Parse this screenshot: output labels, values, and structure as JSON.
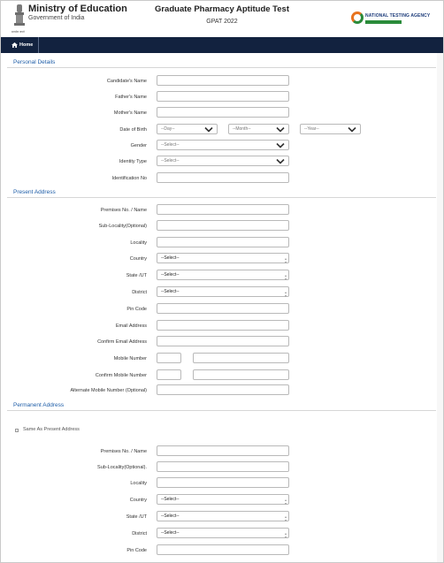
{
  "header": {
    "ministry": "Ministry of Education",
    "government": "Government of India",
    "emblem_caption": "सत्यमेव जयते",
    "title": "Graduate Pharmacy Aptitude Test",
    "subtitle": "GPAT 2022",
    "agency": "NATIONAL TESTING AGENCY"
  },
  "nav": {
    "home": "Home"
  },
  "personal": {
    "heading": "Personal Details",
    "candidate_name": "Candidate's Name",
    "father_name": "Father's Name",
    "mother_name": "Mother's Name",
    "dob": "Date of Birth",
    "dob_day": "--Day--",
    "dob_month": "--Month--",
    "dob_year": "--Year--",
    "gender": "Gender",
    "gender_select": "--Select--",
    "identity_type": "Identity Type",
    "identity_select": "--Select--",
    "identification_no": "Identification No"
  },
  "present": {
    "heading": "Present Address",
    "premises": "Premises No. / Name",
    "sub_locality": "Sub-Locality(Optional)",
    "locality": "Locality",
    "country": "Country",
    "country_select": "--Select--",
    "state": "State /UT",
    "state_select": "--Select--",
    "district": "District",
    "district_select": "--Select--",
    "pin": "Pin Code",
    "email": "Email Address",
    "confirm_email": "Confirm Email Address",
    "mobile": "Mobile Number",
    "confirm_mobile": "Confirm Mobile Number",
    "alt_mobile": "Alternate Mobile Number (Optional)"
  },
  "permanent": {
    "heading": "Permanent Address",
    "same_as": "Same As Present Address",
    "premises": "Premises No. / Name",
    "sub_locality": "Sub-Locality(Optional).",
    "locality": "Locality",
    "country": "Country",
    "country_select": "--Select--",
    "state": "State /UT",
    "state_select": "--Select--",
    "district": "District",
    "district_select": "--Select--",
    "pin": "Pin Code"
  },
  "colors": {
    "nav_bg": "#12223f",
    "section_heading": "#1f5ea8",
    "nta_orange": "#e8731f",
    "nta_green": "#2a8b3a"
  },
  "icons": {
    "home": "home-icon",
    "chevron": "chevron-down-icon",
    "emblem": "national-emblem-icon",
    "agency_logo": "nta-logo-icon"
  }
}
